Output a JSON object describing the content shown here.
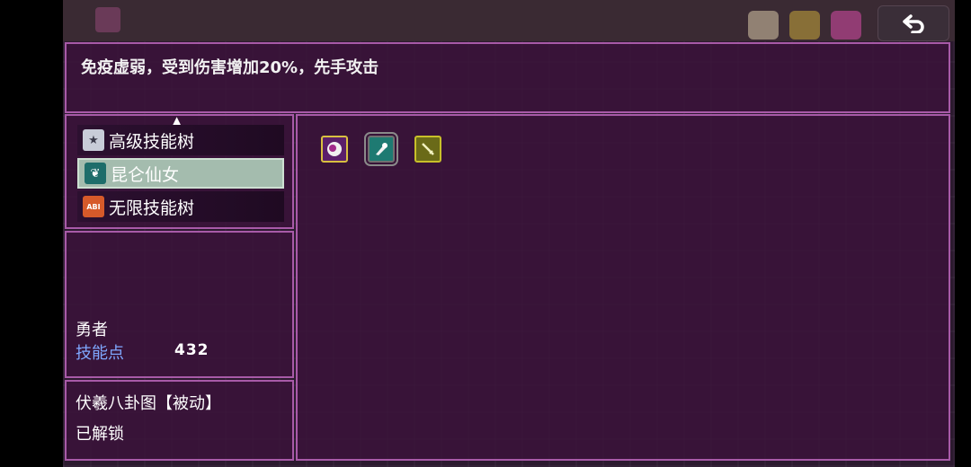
{
  "description": "免疫虚弱，受到伤害增加20%，先手攻击",
  "skill_trees": [
    {
      "label": "高级技能树",
      "icon": "star-icon",
      "icon_text": "★",
      "icon_color": "#c8ccd8"
    },
    {
      "label": "昆仑仙女",
      "icon": "plant-icon",
      "icon_text": "❦",
      "icon_color": "#1e6d6a",
      "selected": true
    },
    {
      "label": "无限技能树",
      "icon": "abi-icon",
      "icon_text": "ABI",
      "icon_color": "#d65a2a"
    }
  ],
  "hero": "勇者",
  "skill_points_label": "技能点",
  "skill_points": "432",
  "selected_skill": {
    "name": "伏羲八卦图【被动】",
    "status": "已解锁"
  },
  "skills": [
    {
      "icon": "orb-icon",
      "border": "#d8c040",
      "fill": "#5a1f6a"
    },
    {
      "icon": "scroll-icon",
      "border": "#707070",
      "fill": "#1e7a72",
      "selected": true
    },
    {
      "icon": "sword-icon",
      "border": "#c8c02a",
      "fill": "#6a6a18"
    }
  ],
  "colors": {
    "panel_border": "#a85aa8",
    "panel_bg": "#3a123a",
    "skill_point_label": "#7fa8ff",
    "selected_tree": "#a4bcae"
  }
}
